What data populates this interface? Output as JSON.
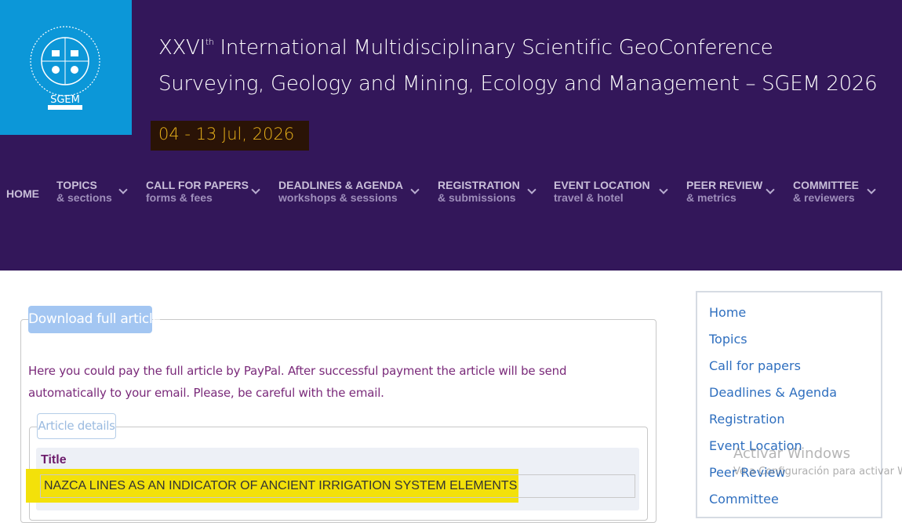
{
  "header": {
    "logo_text": "SGEM",
    "logo_ring_text": "International Multidisciplinary Scientific GeoConference SGEM",
    "title_prefix": "XXVI",
    "title_sup": "th",
    "title_rest": " International Multidisciplinary Scientific GeoConference",
    "subtitle": "Surveying, Geology and Mining, Ecology and Management – SGEM 2026",
    "dates": "04 - 13 Jul, 2026"
  },
  "nav": {
    "home": "HOME",
    "items": [
      {
        "l1": "TOPICS",
        "l2": "& sections"
      },
      {
        "l1": "CALL FOR PAPERS",
        "l2": "forms & fees"
      },
      {
        "l1": "DEADLINES & AGENDA",
        "l2": "workshops & sessions"
      },
      {
        "l1": "REGISTRATION",
        "l2": "& submissions"
      },
      {
        "l1": "EVENT LOCATION",
        "l2": "travel & hotel"
      },
      {
        "l1": "PEER REVIEW",
        "l2": "& metrics"
      },
      {
        "l1": "COMMITTEE",
        "l2": "& reviewers"
      }
    ]
  },
  "main": {
    "download_label": "Download full article",
    "pay_text": "Here you could pay the full article by PayPal. After successful payment the article will be send automatically to your email. Please, be careful with the email.",
    "details_legend": "Article details",
    "title_label": "Title",
    "title_value": "NAZCA LINES AS AN INDICATOR OF ANCIENT IRRIGATION SYSTEM ELEMENTS"
  },
  "sidebar": {
    "items": [
      "Home",
      "Topics",
      "Call for papers",
      "Deadlines & Agenda",
      "Registration",
      "Event Location",
      "Peer Review",
      "Committee"
    ]
  },
  "watermark": {
    "line1": "Activar Windows",
    "line2": "Ve a Configuración para activar Windows."
  },
  "colors": {
    "header_bg": "#33175a",
    "logo_bg": "#0c97d8",
    "date_text": "#e8b11a",
    "highlight": "#f3e10a",
    "link": "#2f6fbf"
  }
}
